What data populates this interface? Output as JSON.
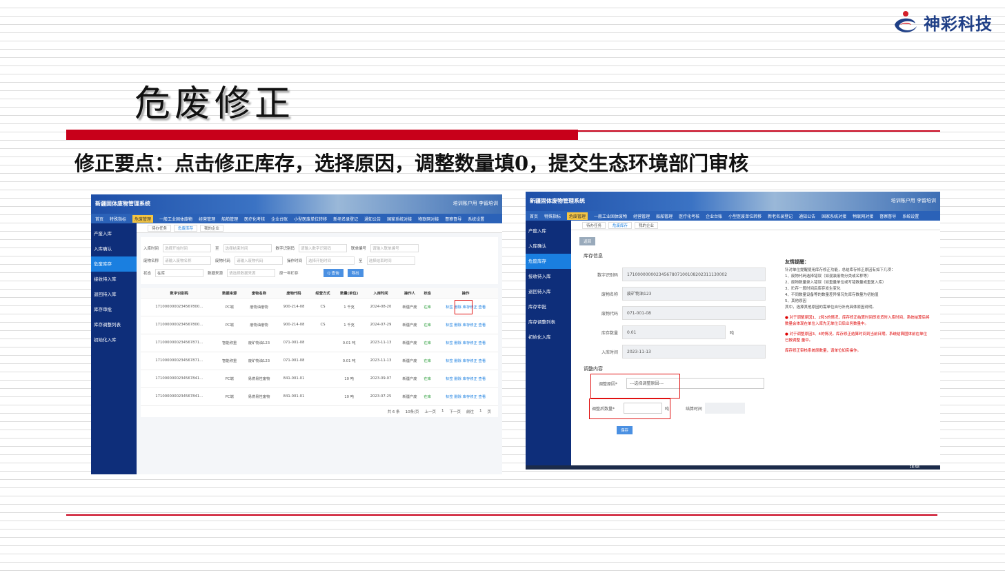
{
  "logo": {
    "text": "神彩科技"
  },
  "slide": {
    "title": "危废修正",
    "subtitle": "修正要点：点击修正库存，选择原因，调整数量填0，提交生态环境部门审核"
  },
  "shot1": {
    "app_title": "新疆固体废物管理系统",
    "user": "培训账户用 李留培训",
    "nav": [
      "首页",
      "特殊指标",
      "危废管理",
      "一般工业固体废物",
      "经营管理",
      "船舶管理",
      "医疗化考核",
      "企业台账",
      "小型医废单位转移",
      "新老名录登记",
      "通知公告",
      "国家系统对接",
      "物联网对接",
      "督察督导",
      "系统设置"
    ],
    "nav_active": "危废管理",
    "side": [
      "产废入库",
      "入库确认",
      "危废库存",
      "接收待入库",
      "退回待入库",
      "库存审批",
      "库存调整列表",
      "初始化入库"
    ],
    "side_active": "危废库存",
    "tabs": [
      "待办任务",
      "危废库存",
      "我的企业"
    ],
    "filters": {
      "r1": [
        [
          "入库时间",
          "选择开始时间"
        ],
        [
          "至",
          "选择结束时间"
        ],
        [
          "数字识别码",
          "请输入数字识别码"
        ],
        [
          "联单编号",
          "请输入联单编号"
        ]
      ],
      "r2": [
        [
          "废物名称",
          "请输入废物名称"
        ],
        [
          "废物代码",
          "请输入废物代码"
        ],
        [
          "操作时间",
          "选择开始时间"
        ],
        [
          "至",
          "选择结束时间"
        ]
      ],
      "status_label": "状态",
      "status_val": "在库",
      "source_label": "数据来源",
      "source_val": "请选择数据来源",
      "checkbox": "原一年贮存",
      "search": "Q 查询",
      "export": "导出"
    },
    "headers": [
      "数字识别码",
      "数据来源",
      "废物名称",
      "废物代码",
      "经营方式",
      "数量(单位)",
      "入库时间",
      "操作人",
      "状态",
      "操作"
    ],
    "rows": [
      [
        "1710000000234567800...",
        "PC端",
        "废物油废物",
        "900-214-08",
        "CS",
        "1 千克",
        "2024-08-20",
        "新疆产废",
        "在库",
        "标签 删除 库存修正 查看"
      ],
      [
        "1710000000234567800...",
        "PC端",
        "废物油废物",
        "900-214-08",
        "CS",
        "1 千克",
        "2024-07-29",
        "新疆产废",
        "在库",
        "标签 删除 库存修正 查看"
      ],
      [
        "1710000000234567871...",
        "智能称重",
        "废矿物油123",
        "071-001-08",
        "",
        "0.01 吨",
        "2023-11-13",
        "新疆产废",
        "在库",
        "标签 删除 库存修正 查看"
      ],
      [
        "1710000000234567871...",
        "智能称重",
        "废矿物油123",
        "071-001-08",
        "",
        "0.01 吨",
        "2023-11-13",
        "新疆产废",
        "在库",
        "标签 删除 库存修正 查看"
      ],
      [
        "1710000000234567841...",
        "PC端",
        "易燃易性废物",
        "841-001-01",
        "",
        "10 吨",
        "2023-09-07",
        "新疆产废",
        "在库",
        "标签 删除 库存修正 查看"
      ],
      [
        "1710000000234567841...",
        "PC端",
        "易燃易性废物",
        "841-001-01",
        "",
        "10 吨",
        "2023-07-25",
        "新疆产废",
        "在库",
        "标签 删除 库存修正 查看"
      ]
    ],
    "pager": [
      "共 6 条",
      "10条/页",
      "上一页",
      "1",
      "下一页",
      "前往",
      "1",
      "页"
    ]
  },
  "shot2": {
    "app_title": "新疆固体废物管理系统",
    "user": "培训账户用 李留培训",
    "back": "返回",
    "section1": "库存信息",
    "fields": [
      [
        "数字识别码",
        "17100000000234567807100108202311130002"
      ],
      [
        "废物名称",
        "废矿物油123"
      ],
      [
        "废物代码",
        "071-001-08"
      ],
      [
        "库存数量",
        "0.01"
      ],
      [
        "入库时间",
        "2023-11-13"
      ]
    ],
    "unit": "吨",
    "section2": "调整内容",
    "reason_label": "调整原因*",
    "reason_val": "---选择调整原因---",
    "qty_label": "调整后数量*",
    "time_label": "结算时间",
    "submit": "保存",
    "notice_title": "友情提醒：",
    "notice": [
      "针对单位提醒使用库存修正功能，总结库存修正原因有如下几项：",
      "1、废物代码选择错误（如混装废物分类或名称等）",
      "2、废物数量录入错误（如重量单位或写错数量或重复入库）",
      "3、贮存一段时间后库存发生变化",
      "4、不同数量设备等的数量差异情况先库存数量为初始值",
      "5、其他原因",
      "其中，选择其他原因的需单位自行补充具体原因说明。"
    ],
    "notice_red": [
      "● 对于调整原因1、2和5的情况，库存修正结算时间即发货时入库时间，系统结算后将 数量会体现在单位入库先无单位日后业务数量中。",
      "● 对于调整原因3、4的情况，库存修正结算时间到当前日期，系统结算固体前在单位已报调整 量中。",
      "库存修正审核系统原数量，请单位如实操作。"
    ],
    "clock": "18:58"
  },
  "colors": {
    "accent_red": "#c8001a",
    "nav_blue": "#2b62b8",
    "side_navy": "#0e2e7a"
  }
}
